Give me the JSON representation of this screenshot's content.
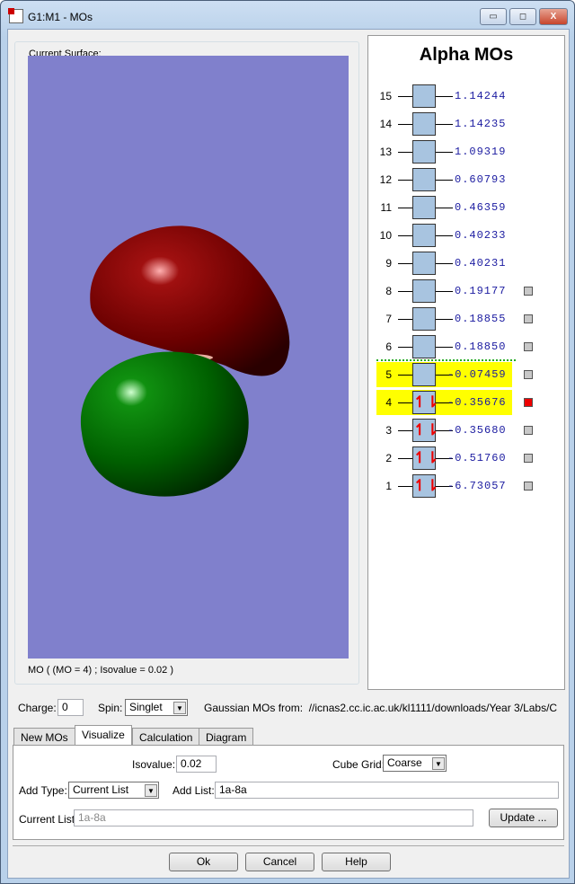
{
  "window": {
    "title": "G1:M1 - MOs",
    "minimize": "▭",
    "maximize": "◻",
    "close": "X"
  },
  "surface": {
    "group_label": "Current Surface:",
    "caption": "MO ( (MO = 4) ; Isovalue = 0.02 )"
  },
  "mo_panel": {
    "title": "Alpha MOs",
    "levels": [
      {
        "n": "15",
        "energy": "1.14244",
        "occupied": false,
        "checkbox": null,
        "highlight": false
      },
      {
        "n": "14",
        "energy": "1.14235",
        "occupied": false,
        "checkbox": null,
        "highlight": false
      },
      {
        "n": "13",
        "energy": "1.09319",
        "occupied": false,
        "checkbox": null,
        "highlight": false
      },
      {
        "n": "12",
        "energy": "0.60793",
        "occupied": false,
        "checkbox": null,
        "highlight": false
      },
      {
        "n": "11",
        "energy": "0.46359",
        "occupied": false,
        "checkbox": null,
        "highlight": false
      },
      {
        "n": "10",
        "energy": "0.40233",
        "occupied": false,
        "checkbox": null,
        "highlight": false
      },
      {
        "n": "9",
        "energy": "0.40231",
        "occupied": false,
        "checkbox": null,
        "highlight": false
      },
      {
        "n": "8",
        "energy": "0.19177",
        "occupied": false,
        "checkbox": "#c8c8c8",
        "highlight": false
      },
      {
        "n": "7",
        "energy": "0.18855",
        "occupied": false,
        "checkbox": "#c8c8c8",
        "highlight": false
      },
      {
        "n": "6",
        "energy": "0.18850",
        "occupied": false,
        "checkbox": "#c8c8c8",
        "highlight": false
      },
      {
        "n": "5",
        "energy": "-0.07459",
        "occupied": false,
        "checkbox": "#c8c8c8",
        "highlight": true
      },
      {
        "n": "4",
        "energy": "-0.35676",
        "occupied": true,
        "checkbox": "#ee0000",
        "highlight": true
      },
      {
        "n": "3",
        "energy": "-0.35680",
        "occupied": true,
        "checkbox": "#c8c8c8",
        "highlight": false
      },
      {
        "n": "2",
        "energy": "-0.51760",
        "occupied": true,
        "checkbox": "#c8c8c8",
        "highlight": false
      },
      {
        "n": "1",
        "energy": "-6.73057",
        "occupied": true,
        "checkbox": "#c8c8c8",
        "highlight": false
      }
    ],
    "occupied_glyph": "↿⇂"
  },
  "params": {
    "charge_label": "Charge:",
    "charge": "0",
    "spin_label": "Spin:",
    "spin": "Singlet",
    "source_label": "Gaussian MOs from:",
    "source": "//icnas2.cc.ic.ac.uk/kl1111/downloads/Year 3/Labs/C"
  },
  "tabs": [
    "New MOs",
    "Visualize",
    "Calculation",
    "Diagram"
  ],
  "visualize": {
    "isovalue_label": "Isovalue:",
    "isovalue": "0.02",
    "cube_grid_label": "Cube Grid:",
    "cube_grid": "Coarse",
    "add_type_label": "Add Type:",
    "add_type": "Current List",
    "add_list_label": "Add List:",
    "add_list": "1a-8a",
    "current_list_label": "Current List:",
    "current_list": "1a-8a",
    "update": "Update ..."
  },
  "footer": {
    "ok": "Ok",
    "cancel": "Cancel",
    "help": "Help"
  }
}
